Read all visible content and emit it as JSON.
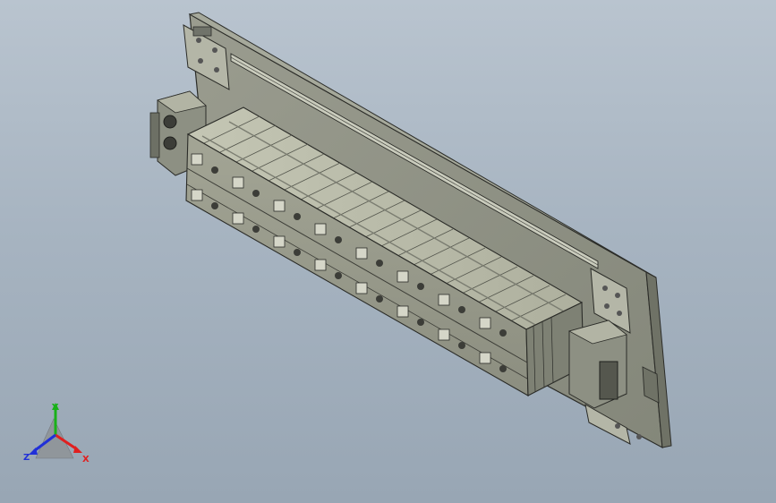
{
  "viewport": {
    "background_top": "#b9c4cf",
    "background_bottom": "#98a6b4"
  },
  "model": {
    "description_icon": "battery-module-fixture-3d-model",
    "plate_color": "#8f9285",
    "cells_color": "#b9bba9",
    "edge_color": "#2b2c28"
  },
  "triad": {
    "x_label": "X",
    "y_label": "Y",
    "z_label": "Z",
    "x_color": "#e02020",
    "y_color": "#19b119",
    "z_color": "#2030d8"
  }
}
